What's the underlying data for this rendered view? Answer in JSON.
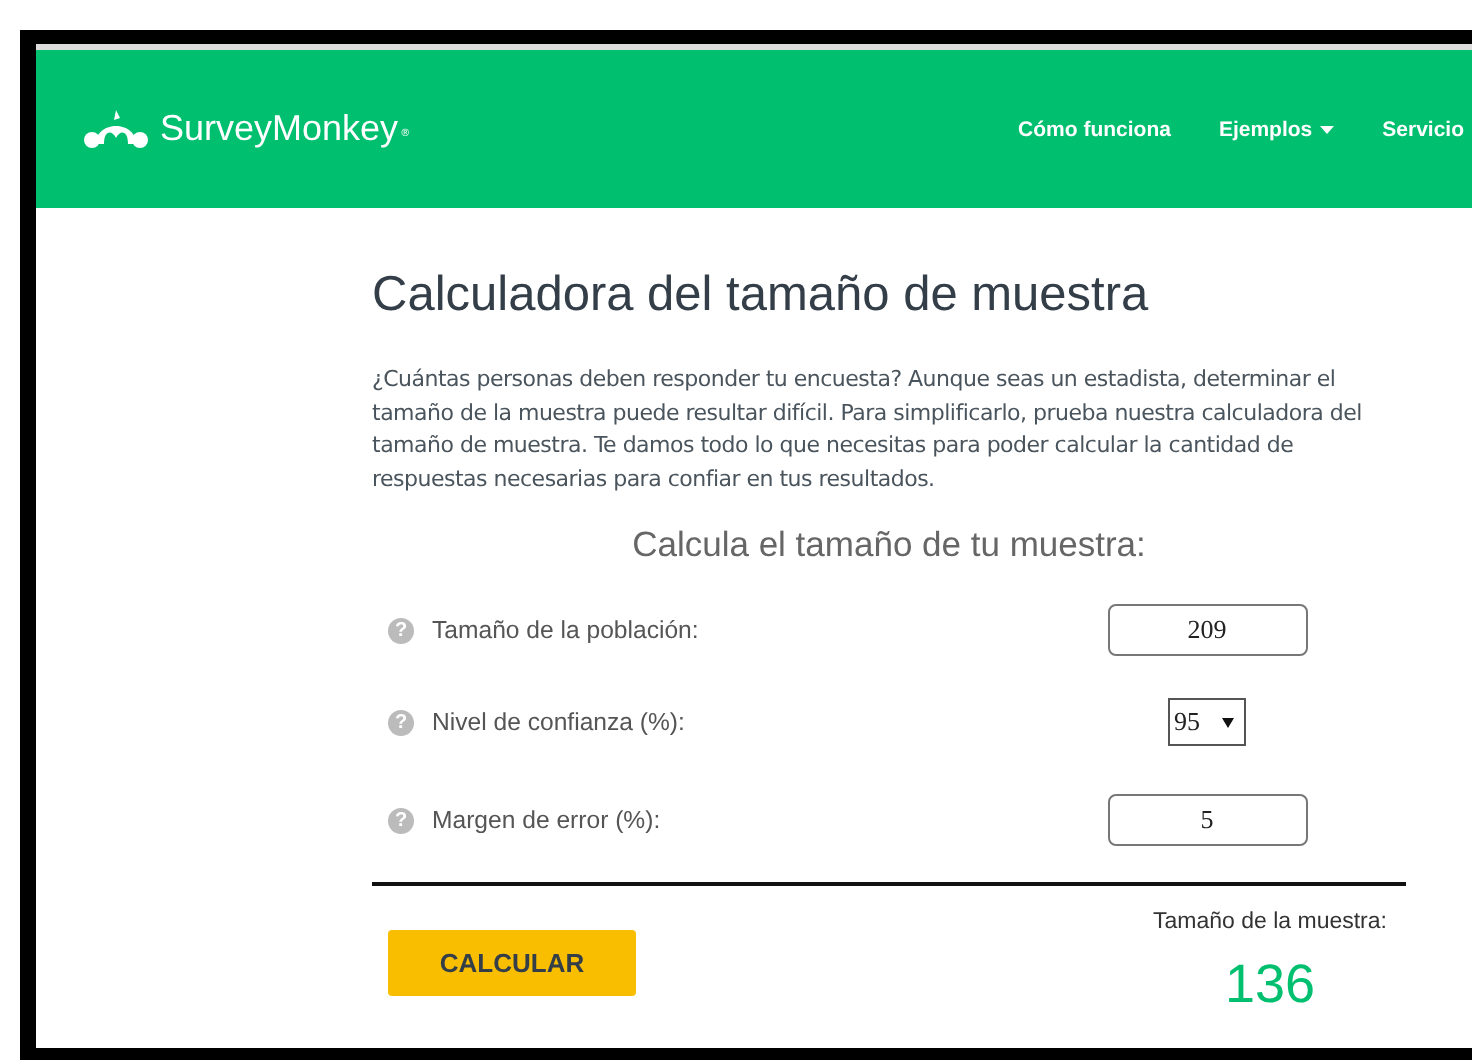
{
  "header": {
    "logo": {
      "name": "SurveyMonkey",
      "mark": "®"
    },
    "nav": [
      {
        "label": "Cómo funciona",
        "dropdown": false
      },
      {
        "label": "Ejemplos",
        "dropdown": true
      },
      {
        "label": "Servicio",
        "dropdown": false
      }
    ]
  },
  "page": {
    "title": "Calculadora del tamaño de muestra",
    "intro": "¿Cuántas personas deben responder tu encuesta? Aunque seas un estadista, determinar el tamaño de la muestra puede resultar difícil. Para simplificarlo, prueba nuestra calculadora del tamaño de muestra. Te damos todo lo que necesitas para poder calcular la cantidad de respuestas necesarias para confiar en tus resultados.",
    "calculator": {
      "heading": "Calcula el tamaño de tu muestra:",
      "fields": [
        {
          "kind": "input",
          "help": "?",
          "label": "Tamaño de la población:",
          "value": "209"
        },
        {
          "kind": "select",
          "help": "?",
          "label": "Nivel de confianza (%):",
          "value": "95"
        },
        {
          "kind": "input",
          "help": "?",
          "label": "Margen de error (%):",
          "value": "5"
        }
      ],
      "button": "CALCULAR",
      "result_label": "Tamaño de la muestra:",
      "result_value": "136"
    }
  }
}
